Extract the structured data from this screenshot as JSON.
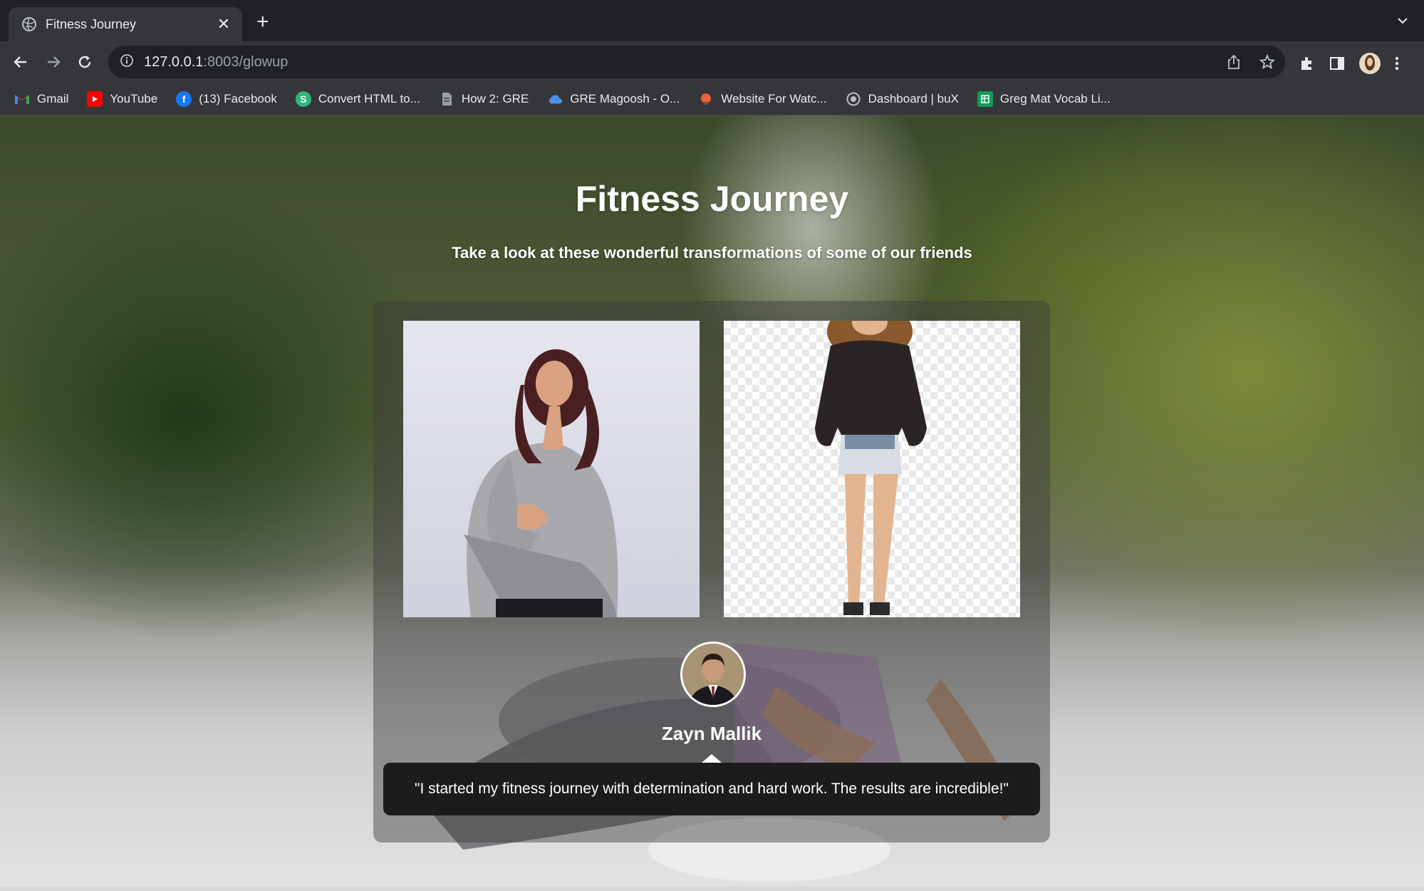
{
  "browser": {
    "tab": {
      "title": "Fitness Journey",
      "close_glyph": "✕"
    },
    "new_tab_glyph": "+",
    "address": {
      "host": "127.0.0.1",
      "path": ":8003/glowup"
    },
    "bookmarks": [
      {
        "label": "Gmail",
        "icon": "gmail-icon",
        "color": "#ea4335"
      },
      {
        "label": "YouTube",
        "icon": "youtube-icon",
        "color": "#ff0000"
      },
      {
        "label": "(13) Facebook",
        "icon": "facebook-icon",
        "color": "#1877f2"
      },
      {
        "label": "Convert HTML to...",
        "icon": "convert-icon",
        "color": "#2eb67d"
      },
      {
        "label": "How 2: GRE",
        "icon": "document-icon",
        "color": "#9aa0a6"
      },
      {
        "label": "GRE Magoosh - O...",
        "icon": "cloud-icon",
        "color": "#4a90e2"
      },
      {
        "label": "Website For Watc...",
        "icon": "website-icon",
        "color": "#e8613c"
      },
      {
        "label": "Dashboard | buX",
        "icon": "dashboard-icon",
        "color": "#bdbdbd"
      },
      {
        "label": "Greg Mat Vocab Li...",
        "icon": "sheets-icon",
        "color": "#0f9d58"
      }
    ]
  },
  "page": {
    "title": "Fitness Journey",
    "subtitle": "Take a look at these wonderful transformations of some of our friends",
    "testimonial": {
      "name": "Zayn Mallik",
      "quote": "\"I started my fitness journey with determination and hard work. The results are incredible!\""
    }
  }
}
